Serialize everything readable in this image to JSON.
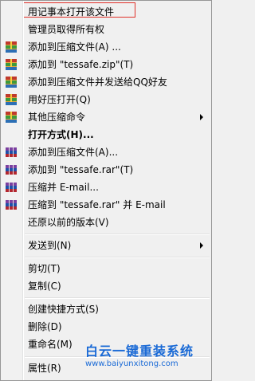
{
  "menu": {
    "items": [
      {
        "label": "用记事本打开该文件",
        "icon": "none"
      },
      {
        "label": "管理员取得所有权",
        "icon": "none"
      },
      {
        "label": "添加到压缩文件(A) ...",
        "icon": "zip-archive-icon"
      },
      {
        "label": "添加到 \"tessafe.zip\"(T)",
        "icon": "zip-archive-icon"
      },
      {
        "label": "添加到压缩文件并发送给QQ好友",
        "icon": "zip-archive-icon"
      },
      {
        "label": "用好压打开(Q)",
        "icon": "zip-archive-icon"
      },
      {
        "label": "其他压缩命令",
        "icon": "zip-archive-icon"
      },
      {
        "label": "打开方式(H)...",
        "icon": "none"
      },
      {
        "label": "添加到压缩文件(A)...",
        "icon": "winrar-books-icon"
      },
      {
        "label": "添加到 \"tessafe.rar\"(T)",
        "icon": "winrar-books-icon"
      },
      {
        "label": "压缩并 E-mail...",
        "icon": "winrar-books-icon"
      },
      {
        "label": "压缩到 \"tessafe.rar\" 并 E-mail",
        "icon": "winrar-books-icon"
      },
      {
        "label": "还原以前的版本(V)",
        "icon": "none"
      },
      {
        "label": "发送到(N)",
        "icon": "none"
      },
      {
        "label": "剪切(T)",
        "icon": "none"
      },
      {
        "label": "复制(C)",
        "icon": "none"
      },
      {
        "label": "创建快捷方式(S)",
        "icon": "none"
      },
      {
        "label": "删除(D)",
        "icon": "none"
      },
      {
        "label": "重命名(M)",
        "icon": "none"
      },
      {
        "label": "属性(R)",
        "icon": "none"
      }
    ]
  },
  "watermark": {
    "title": "白云一键重装系统",
    "url": "www.baiyunxitong.com"
  },
  "colors": {
    "highlight_border": "#e0312a",
    "watermark": "#1a6ad6"
  }
}
